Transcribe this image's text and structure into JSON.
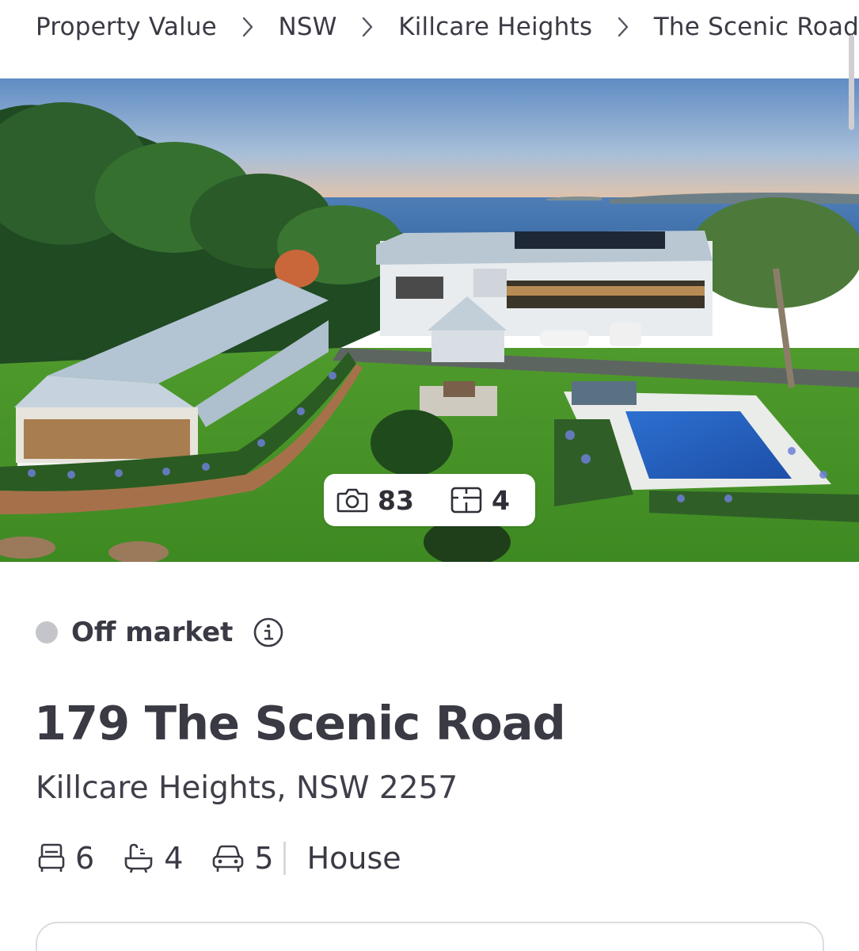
{
  "breadcrumb": {
    "items": [
      "Property Value",
      "NSW",
      "Killcare Heights",
      "The Scenic Road"
    ]
  },
  "hero": {
    "photo_count": "83",
    "floorplan_count": "4",
    "icons": {
      "photos": "camera-icon",
      "floorplans": "floorplan-icon"
    }
  },
  "listing": {
    "status": "Off market",
    "status_color": "#c4c4cb",
    "address": "179 The Scenic Road",
    "suburb_line": "Killcare Heights, NSW 2257",
    "bedrooms": "6",
    "bathrooms": "4",
    "car_spaces": "5",
    "property_type": "House",
    "icons": {
      "bed": "bed-icon",
      "bath": "bath-icon",
      "car": "car-icon",
      "info": "info-icon"
    }
  }
}
